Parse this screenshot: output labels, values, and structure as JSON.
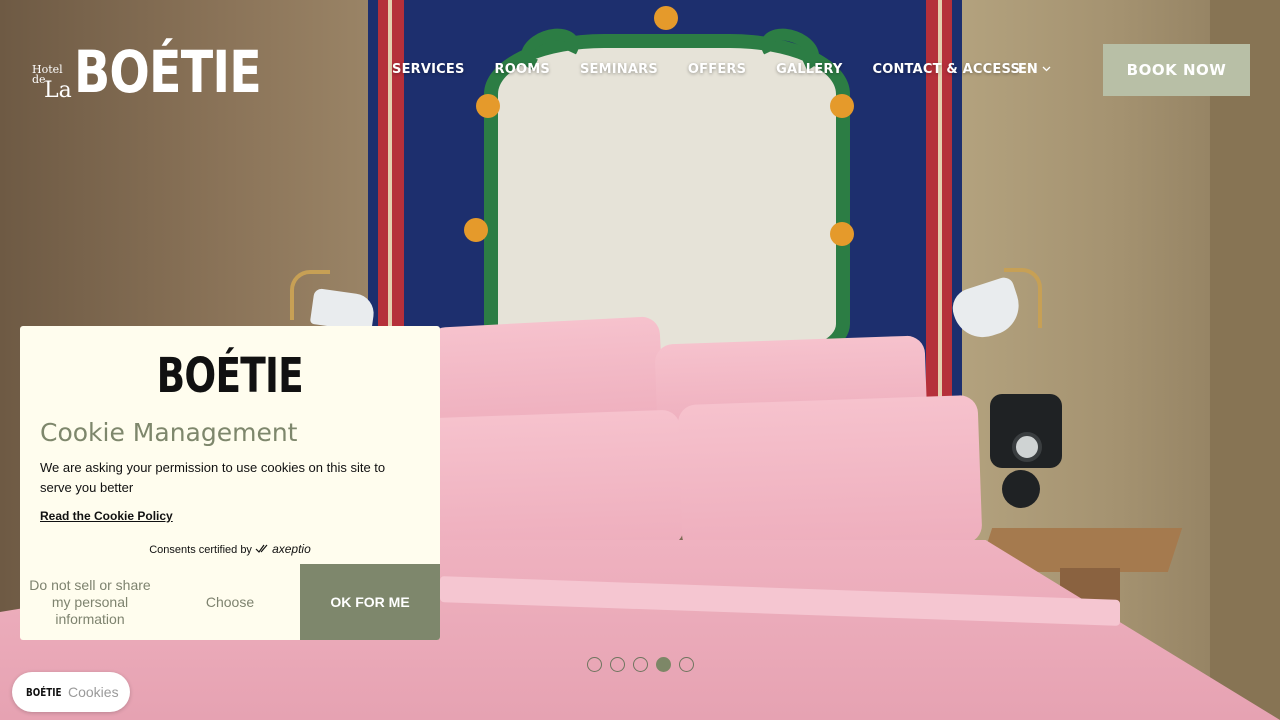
{
  "logo": {
    "hotel": "Hotel",
    "de": "de",
    "la": "La",
    "name": "BOÉTIE"
  },
  "nav": {
    "items": [
      {
        "label": "SERVICES"
      },
      {
        "label": "ROOMS"
      },
      {
        "label": "SEMINARS"
      },
      {
        "label": "OFFERS"
      },
      {
        "label": "GALLERY"
      },
      {
        "label": "CONTACT & ACCESS"
      }
    ]
  },
  "language": {
    "current": "EN",
    "icon": "chevron-down-icon"
  },
  "book_button": {
    "label": "BOOK NOW",
    "color": "#b8bfa6"
  },
  "carousel": {
    "slide_count": 5,
    "active_slide": 4
  },
  "cookie_banner": {
    "logo": "BOÉTIE",
    "title": "Cookie Management",
    "message": "We are asking your permission to use cookies on this site to serve you better",
    "policy_link": "Read the Cookie Policy",
    "certified_prefix": "Consents certified by",
    "certified_brand": "axeptio",
    "actions": {
      "decline": "Do not sell or share my personal information",
      "choose": "Choose",
      "accept": "OK FOR ME"
    },
    "accent_color": "#7e876c",
    "background": "#fffdee"
  },
  "cookie_pill": {
    "logo": "BOÉTIE",
    "label": "Cookies"
  }
}
